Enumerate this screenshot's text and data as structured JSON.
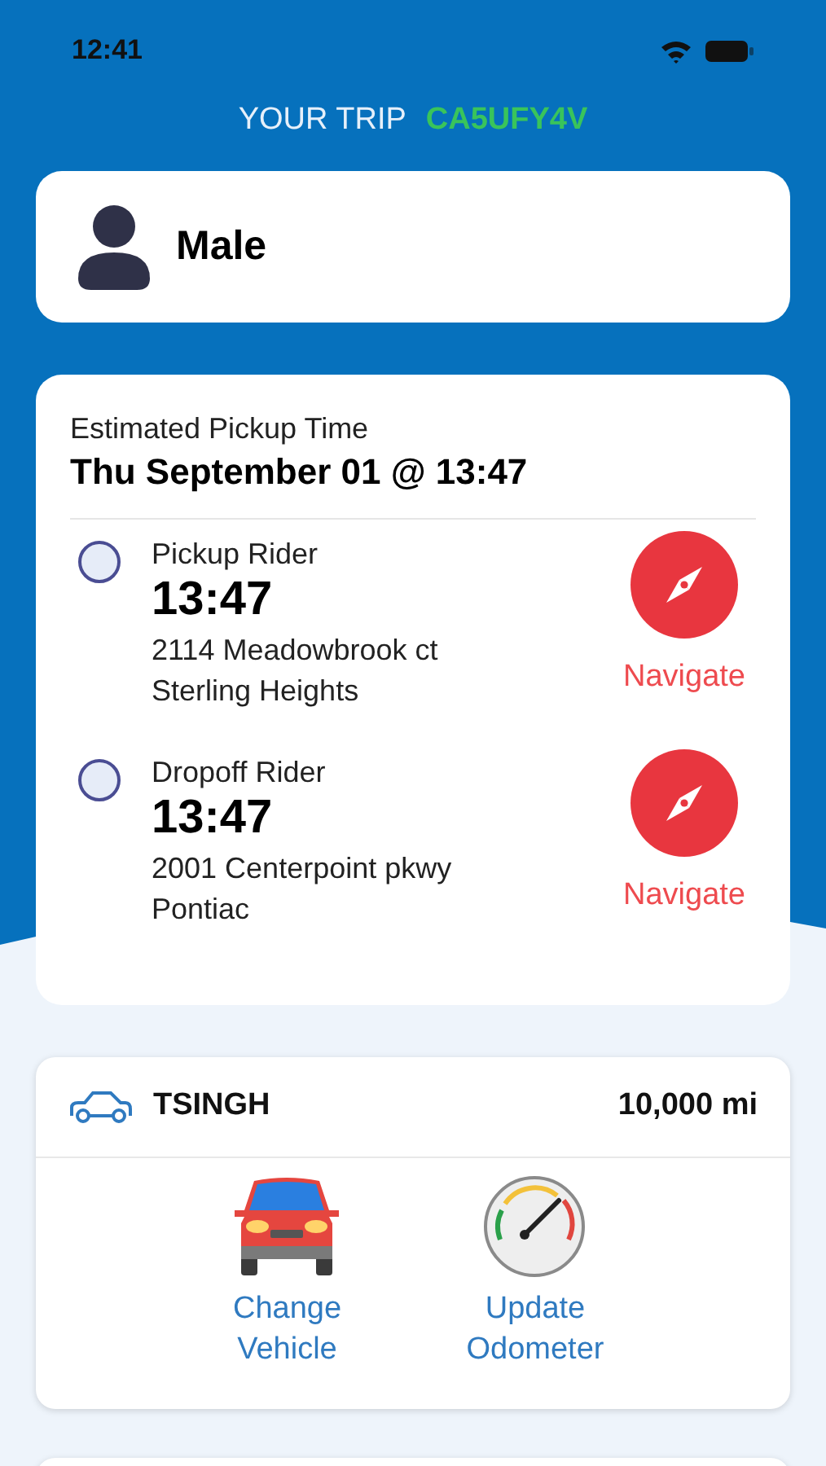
{
  "status_bar": {
    "time": "12:41"
  },
  "header": {
    "label": "YOUR TRIP",
    "trip_code": "CA5UFY4V"
  },
  "rider": {
    "gender": "Male"
  },
  "schedule": {
    "label": "Estimated Pickup Time",
    "datetime": "Thu September 01 @ 13:47",
    "stops": [
      {
        "title": "Pickup Rider",
        "time": "13:47",
        "address_line_1": "2114 Meadowbrook ct",
        "address_line_2": "Sterling Heights",
        "checked": false,
        "action": "Navigate"
      },
      {
        "title": "Dropoff Rider",
        "time": "13:47",
        "address_line_1": "2001 Centerpoint pkwy",
        "address_line_2": "Pontiac",
        "checked": false,
        "action": "Navigate"
      }
    ]
  },
  "vehicle": {
    "name": "TSINGH",
    "odometer": "10,000 mi",
    "actions": [
      {
        "kind": "car",
        "label_line_1": "Change",
        "label_line_2": "Vehicle"
      },
      {
        "kind": "gauge",
        "label_line_1": "Update",
        "label_line_2": "Odometer"
      }
    ]
  }
}
